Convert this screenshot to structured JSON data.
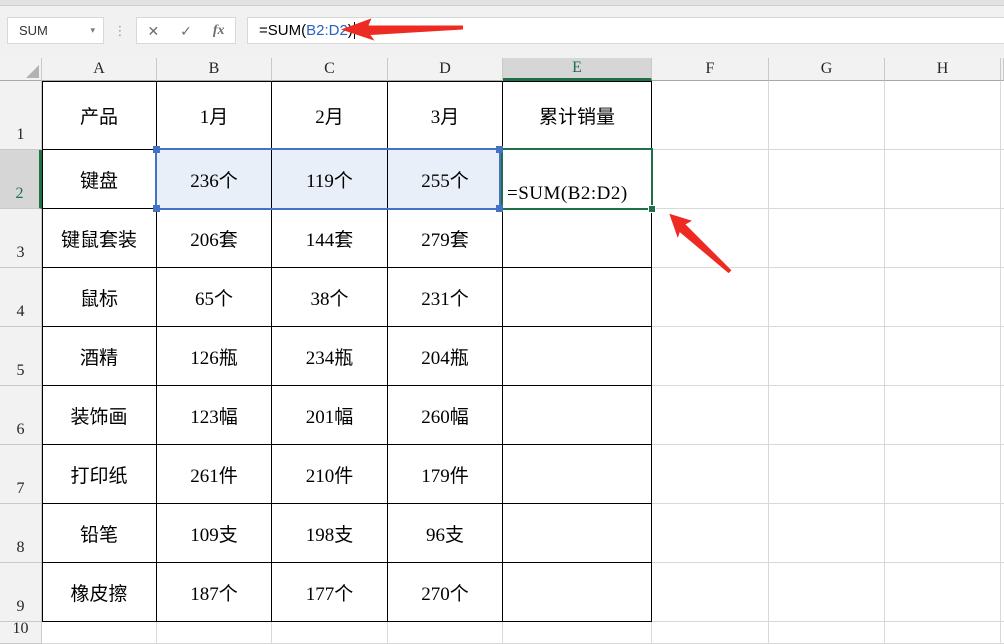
{
  "formula_bar": {
    "name_box": "SUM",
    "caret_icon": "▾",
    "dots_icon": "⋮",
    "cancel_icon": "✕",
    "enter_icon": "✓",
    "fx_icon": "fx",
    "formula_prefix": "=SUM(",
    "formula_ref": "B2:D2",
    "formula_suffix": ")"
  },
  "sheet": {
    "column_headers": [
      "A",
      "B",
      "C",
      "D",
      "E",
      "F",
      "G",
      "H"
    ],
    "row_headers": [
      "1",
      "2",
      "3",
      "4",
      "5",
      "6",
      "7",
      "8",
      "9",
      "10"
    ],
    "active_column": "E",
    "active_row": "2",
    "active_cell_formula": "=SUM(B2:D2)",
    "table": {
      "header_cells": [
        "产品",
        "1月",
        "2月",
        "3月",
        "累计销量"
      ],
      "rows": [
        [
          "键盘",
          "236个",
          "119个",
          "255个",
          ""
        ],
        [
          "键鼠套装",
          "206套",
          "144套",
          "279套",
          ""
        ],
        [
          "鼠标",
          "65个",
          "38个",
          "231个",
          ""
        ],
        [
          "酒精",
          "126瓶",
          "234瓶",
          "204瓶",
          ""
        ],
        [
          "装饰画",
          "123幅",
          "201幅",
          "260幅",
          ""
        ],
        [
          "打印纸",
          "261件",
          "210件",
          "179件",
          ""
        ],
        [
          "铅笔",
          "109支",
          "198支",
          "96支",
          ""
        ],
        [
          "橡皮擦",
          "187个",
          "177个",
          "270个",
          ""
        ]
      ]
    }
  },
  "colors": {
    "accent_green": "#1F7145",
    "selection_blue": "#4472C4",
    "selection_fill": "#E9EFF8",
    "reference_blue": "#2A62C4",
    "arrow_red": "#EE2B23"
  }
}
